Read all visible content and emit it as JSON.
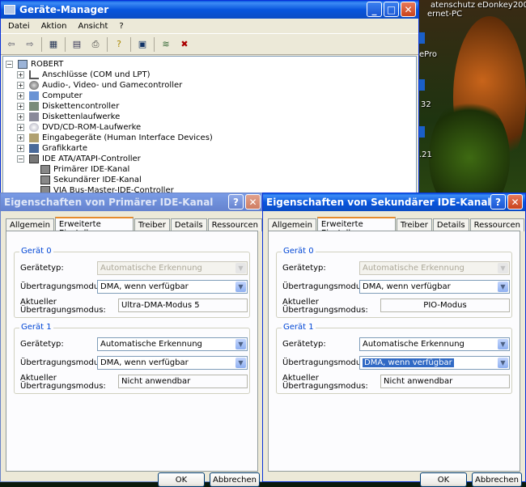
{
  "desktop": {
    "labels": [
      "atenschutz",
      "eDonkey2000",
      "ernet-PC",
      "ePro",
      "32",
      ".21"
    ]
  },
  "devmgr": {
    "title": "Geräte-Manager",
    "menu": [
      "Datei",
      "Aktion",
      "Ansicht",
      "?"
    ],
    "root": "ROBERT",
    "items": [
      "Anschlüsse (COM und LPT)",
      "Audio-, Video- und Gamecontroller",
      "Computer",
      "Diskettencontroller",
      "Diskettenlaufwerke",
      "DVD/CD-ROM-Laufwerke",
      "Eingabegeräte (Human Interface Devices)",
      "Grafikkarte",
      "IDE ATA/ATAPI-Controller"
    ],
    "children": [
      "Primärer IDE-Kanal",
      "Sekundärer IDE-Kanal",
      "VIA Bus-Master-IDE-Controller"
    ]
  },
  "tabs": [
    "Allgemein",
    "Erweiterte Einstellungen",
    "Treiber",
    "Details",
    "Ressourcen"
  ],
  "labels": {
    "group0": "Gerät 0",
    "group1": "Gerät 1",
    "devtype": "Gerätetyp:",
    "mode": "Übertragungsmodus:",
    "current1": "Aktueller",
    "current2": "Übertragungsmodus:"
  },
  "buttons": {
    "ok": "OK",
    "cancel": "Abbrechen",
    "help": "?"
  },
  "dlg1": {
    "title": "Eigenschaften von Primärer IDE-Kanal",
    "d0_type": "Automatische Erkennung",
    "d0_mode": "DMA, wenn verfügbar",
    "d0_current": "Ultra-DMA-Modus 5",
    "d1_type": "Automatische Erkennung",
    "d1_mode": "DMA, wenn verfügbar",
    "d1_current": "Nicht anwendbar"
  },
  "dlg2": {
    "title": "Eigenschaften von Sekundärer IDE-Kanal",
    "d0_type": "Automatische Erkennung",
    "d0_mode": "DMA, wenn verfügbar",
    "d0_current": "PIO-Modus",
    "d1_type": "Automatische Erkennung",
    "d1_mode": "DMA, wenn verfügbar",
    "d1_current": "Nicht anwendbar"
  }
}
